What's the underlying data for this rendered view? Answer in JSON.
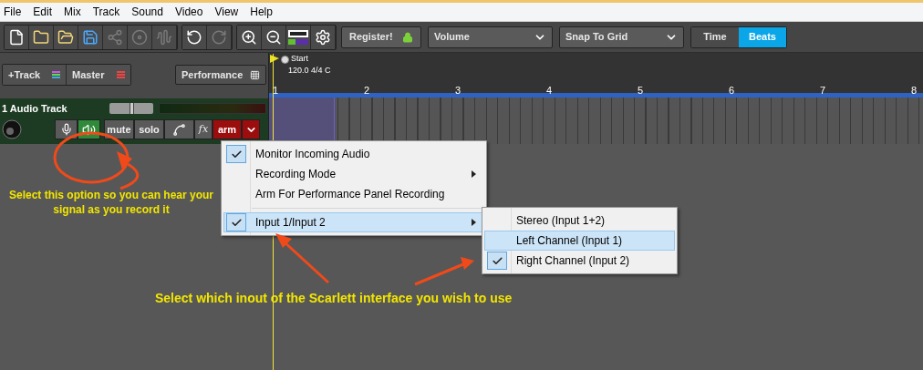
{
  "menu_bar": [
    "File",
    "Edit",
    "Mix",
    "Track",
    "Sound",
    "Video",
    "View",
    "Help"
  ],
  "toolbar": {
    "register_button": "Register!",
    "volume_select": "Volume",
    "snap_select": "Snap To Grid",
    "view_modes": [
      {
        "label": "Time",
        "selected": false
      },
      {
        "label": "Beats",
        "selected": true
      }
    ]
  },
  "track_buttons": {
    "add_track": "+Track",
    "master": "Master",
    "performance": "Performance"
  },
  "timeline": {
    "marker": "Start",
    "tempo": "120.0 4/4 C",
    "bars": [
      "1",
      "2",
      "3",
      "4",
      "5",
      "6",
      "7",
      "8"
    ]
  },
  "track": {
    "name": "1 Audio Track",
    "monitor_on": true,
    "armed": true,
    "mute": "mute",
    "solo": "solo",
    "fx": "fx",
    "arm": "arm"
  },
  "context_menu": {
    "items": [
      {
        "kind": "item",
        "label": "Monitor Incoming Audio",
        "checked": true,
        "selected": false,
        "submenu": false
      },
      {
        "kind": "item",
        "label": "Recording Mode",
        "checked": false,
        "selected": false,
        "submenu": true
      },
      {
        "kind": "item",
        "label": "Arm For Performance Panel Recording",
        "checked": false,
        "selected": false,
        "submenu": false
      },
      {
        "kind": "separator"
      },
      {
        "kind": "item",
        "label": "Input 1/Input 2",
        "checked": true,
        "selected": true,
        "submenu": true
      }
    ]
  },
  "submenu": {
    "items": [
      {
        "kind": "item",
        "label": "Stereo (Input 1+2)",
        "checked": false,
        "selected": false,
        "submenu": false
      },
      {
        "kind": "item",
        "label": "Left Channel (Input 1)",
        "checked": false,
        "selected": true,
        "submenu": false
      },
      {
        "kind": "item",
        "label": "Right Channel (Input 2)",
        "checked": true,
        "selected": false,
        "submenu": false
      }
    ]
  },
  "annotations": [
    "Select this option so you can hear your signal as you record it",
    "Select which inout of the Scarlett interface you wish to use"
  ]
}
